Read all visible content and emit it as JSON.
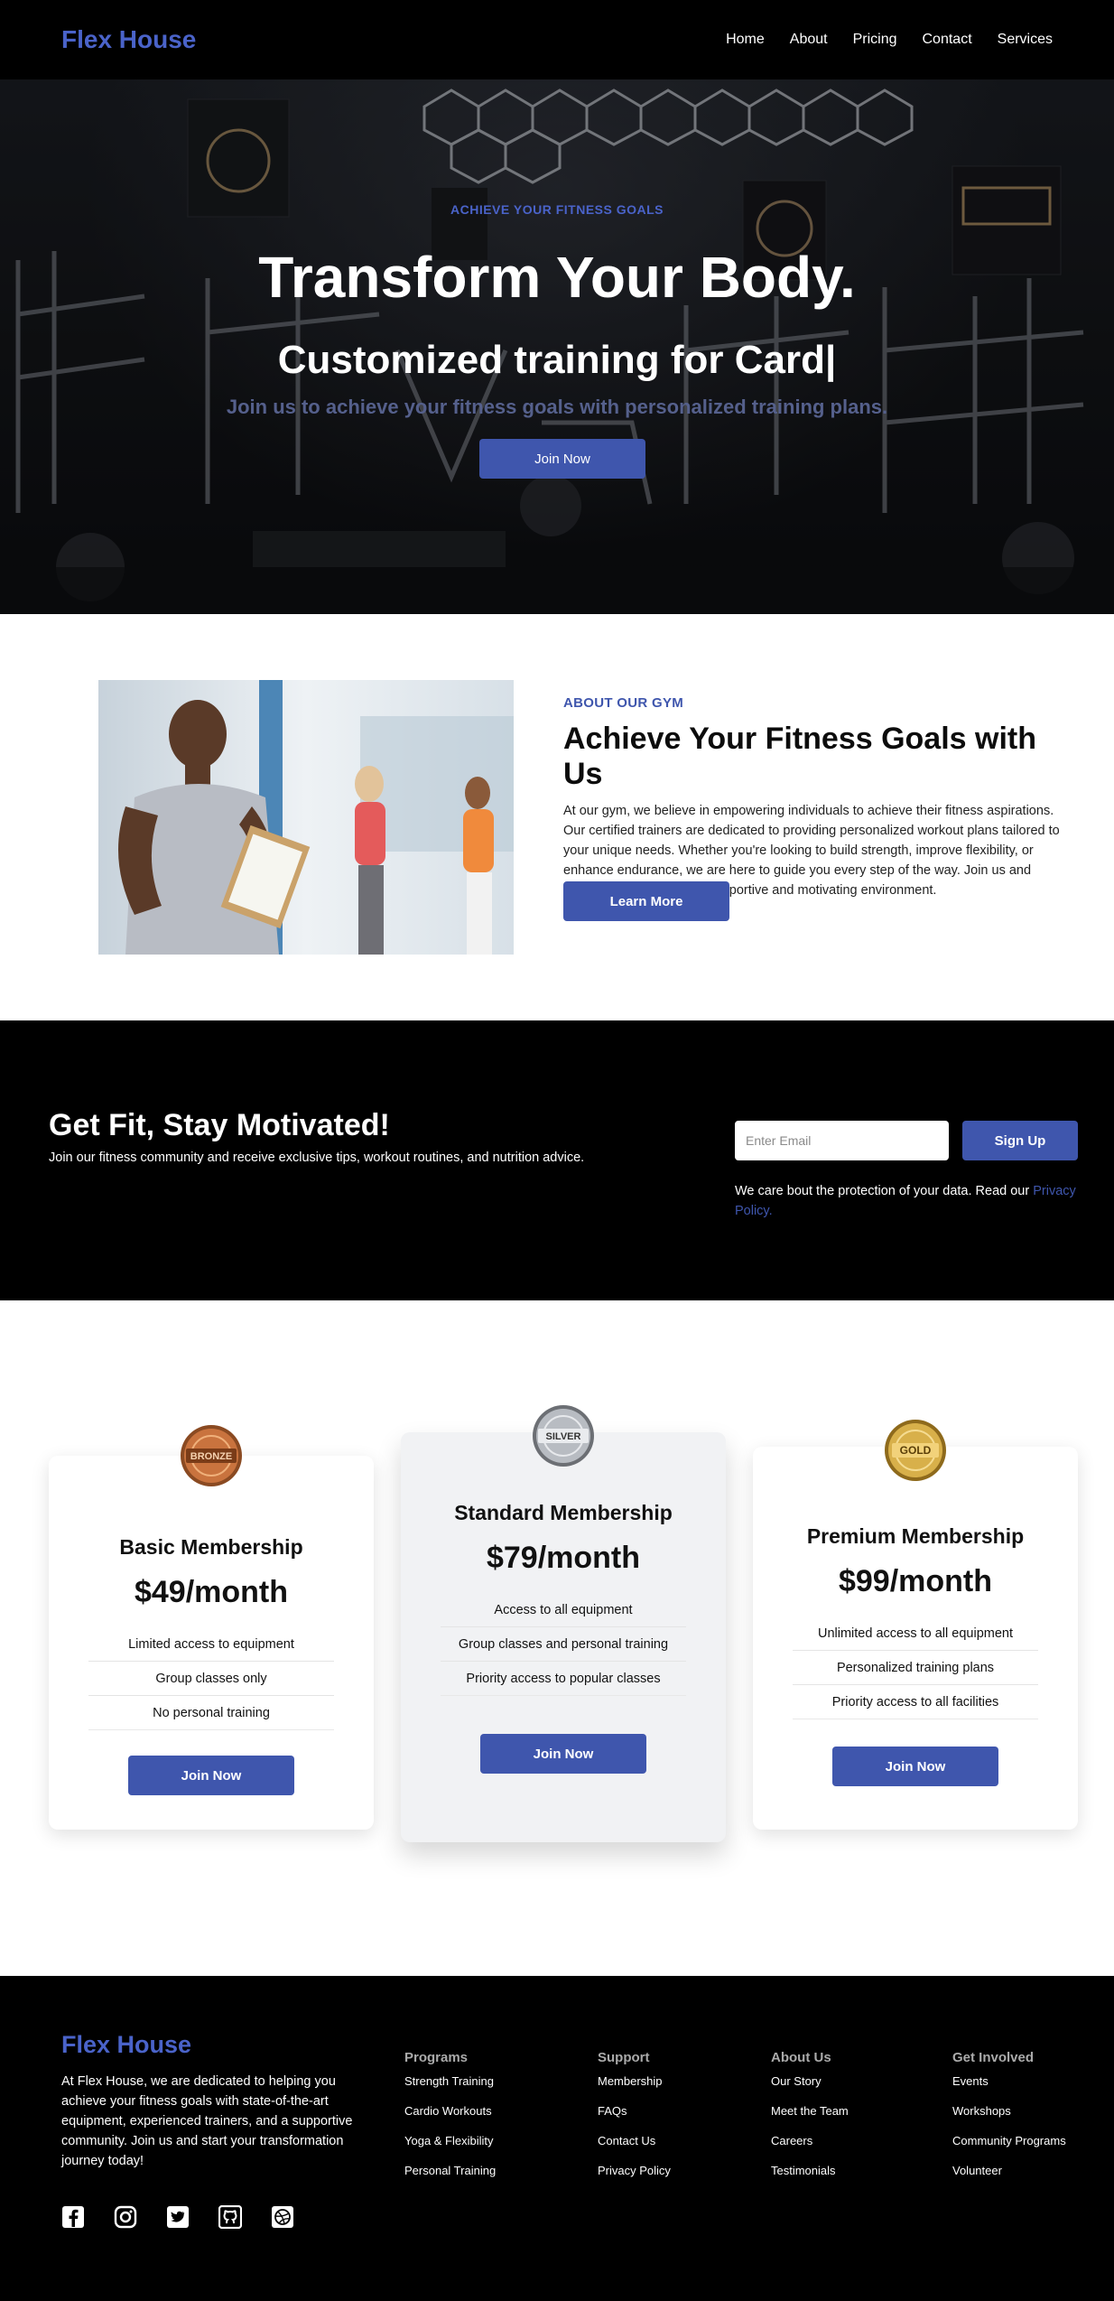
{
  "nav": {
    "brand": "Flex House",
    "links": [
      "Home",
      "About",
      "Pricing",
      "Contact",
      "Services"
    ]
  },
  "hero": {
    "eyebrow": "ACHIEVE YOUR FITNESS GOALS",
    "title": "Transform Your Body.",
    "subtitle": "Customized training for Card|",
    "description": "Join us to achieve your fitness goals with personalized training plans.",
    "button": "Join Now"
  },
  "about": {
    "eyebrow": "ABOUT OUR GYM",
    "title": "Achieve Your Fitness Goals with Us",
    "body": "At our gym, we believe in empowering individuals to achieve their fitness aspirations. Our certified trainers are dedicated to providing personalized workout plans tailored to your unique needs. Whether you're looking to build strength, improve flexibility, or enhance endurance, we are here to guide you every step of the way. Join us and transform your body in a supportive and motivating environment.",
    "button": "Learn More"
  },
  "newsletter": {
    "title": "Get Fit, Stay Motivated!",
    "subtitle": "Join our fitness community and receive exclusive tips, workout routines, and nutrition advice.",
    "input_placeholder": "Enter Email",
    "button": "Sign Up",
    "privacy_text": "We care bout the protection of your data. Read our",
    "privacy_link": "Privacy Policy."
  },
  "pricing": {
    "plans": [
      {
        "badge": "BRONZE",
        "title": "Basic Membership",
        "price": "$49/month",
        "features": [
          "Limited access to equipment",
          "Group classes only",
          "No personal training"
        ],
        "button": "Join Now"
      },
      {
        "badge": "SILVER",
        "title": "Standard Membership",
        "price": "$79/month",
        "features": [
          "Access to all equipment",
          "Group classes and personal training",
          "Priority access to popular classes"
        ],
        "button": "Join Now"
      },
      {
        "badge": "GOLD",
        "title": "Premium Membership",
        "price": "$99/month",
        "features": [
          "Unlimited access to all equipment",
          "Personalized training plans",
          "Priority access to all facilities"
        ],
        "button": "Join Now"
      }
    ]
  },
  "footer": {
    "brand": "Flex House",
    "description": "At Flex House, we are dedicated to helping you achieve your fitness goals with state-of-the-art equipment, experienced trainers, and a supportive community. Join us and start your transformation journey today!",
    "socials": [
      "facebook-icon",
      "instagram-icon",
      "twitter-icon",
      "github-icon",
      "dribbble-icon"
    ],
    "columns": [
      {
        "title": "Programs",
        "links": [
          "Strength Training",
          "Cardio Workouts",
          "Yoga & Flexibility",
          "Personal Training"
        ]
      },
      {
        "title": "Support",
        "links": [
          "Membership",
          "FAQs",
          "Contact Us",
          "Privacy Policy"
        ]
      },
      {
        "title": "About Us",
        "links": [
          "Our Story",
          "Meet the Team",
          "Careers",
          "Testimonials"
        ]
      },
      {
        "title": "Get Involved",
        "links": [
          "Events",
          "Workshops",
          "Community Programs",
          "Volunteer"
        ]
      }
    ]
  },
  "colors": {
    "accent": "#3f56ad",
    "brand": "#4a63c9",
    "dark": "#000000"
  }
}
